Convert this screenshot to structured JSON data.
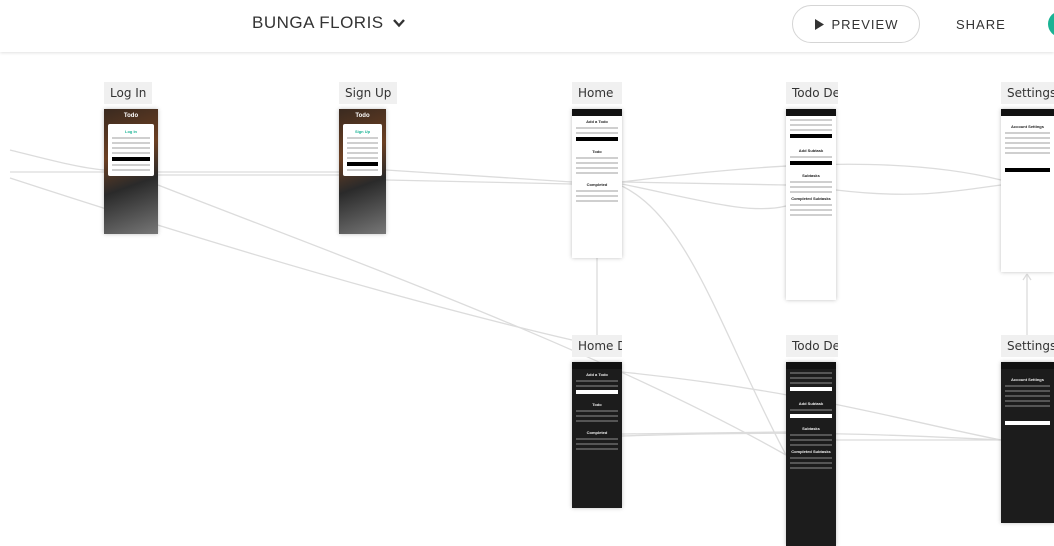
{
  "header": {
    "project_name": "BUNGA FLORIS",
    "preview_label": "PREVIEW",
    "share_label": "SHARE"
  },
  "screens": {
    "login": {
      "label": "Log In",
      "brand": "Todo",
      "title": "Log In"
    },
    "signup": {
      "label": "Sign Up",
      "brand": "Todo",
      "title": "Sign Up"
    },
    "home": {
      "label": "Home",
      "title": "Add a Todo",
      "section1": "Todo",
      "section2": "Completed"
    },
    "todo_detail": {
      "label": "Todo De",
      "section1": "Add Subtask",
      "section2": "Subtasks",
      "section3": "Completed Subtasks"
    },
    "settings": {
      "label": "Settings",
      "title": "Account Settings"
    },
    "home_dark": {
      "label": "Home Da",
      "title": "Add a Todo",
      "section1": "Todo",
      "section2": "Completed"
    },
    "todo_detail_dark": {
      "label": "Todo Det",
      "section1": "Add Subtask",
      "section2": "Subtasks",
      "section3": "Completed Subtasks"
    },
    "settings_dark": {
      "label": "Settings",
      "title": "Account Settings"
    }
  },
  "colors": {
    "accent": "#1ab394",
    "wire": "#dcdcdc",
    "dark_screen": "#1c1c1c"
  },
  "icons": [
    "chevron-down-icon",
    "play-icon"
  ]
}
